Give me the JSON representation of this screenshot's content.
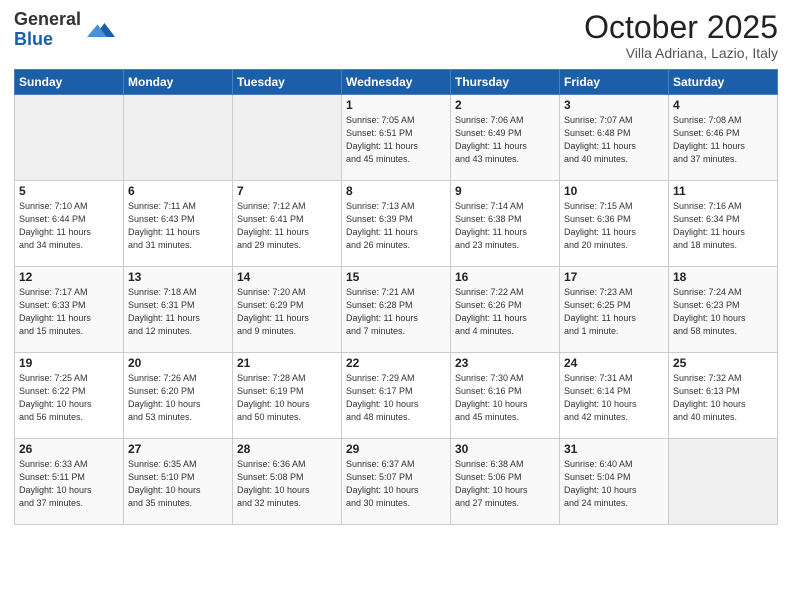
{
  "logo": {
    "general": "General",
    "blue": "Blue"
  },
  "header": {
    "month": "October 2025",
    "location": "Villa Adriana, Lazio, Italy"
  },
  "weekdays": [
    "Sunday",
    "Monday",
    "Tuesday",
    "Wednesday",
    "Thursday",
    "Friday",
    "Saturday"
  ],
  "weeks": [
    [
      {
        "day": "",
        "info": ""
      },
      {
        "day": "",
        "info": ""
      },
      {
        "day": "",
        "info": ""
      },
      {
        "day": "1",
        "info": "Sunrise: 7:05 AM\nSunset: 6:51 PM\nDaylight: 11 hours\nand 45 minutes."
      },
      {
        "day": "2",
        "info": "Sunrise: 7:06 AM\nSunset: 6:49 PM\nDaylight: 11 hours\nand 43 minutes."
      },
      {
        "day": "3",
        "info": "Sunrise: 7:07 AM\nSunset: 6:48 PM\nDaylight: 11 hours\nand 40 minutes."
      },
      {
        "day": "4",
        "info": "Sunrise: 7:08 AM\nSunset: 6:46 PM\nDaylight: 11 hours\nand 37 minutes."
      }
    ],
    [
      {
        "day": "5",
        "info": "Sunrise: 7:10 AM\nSunset: 6:44 PM\nDaylight: 11 hours\nand 34 minutes."
      },
      {
        "day": "6",
        "info": "Sunrise: 7:11 AM\nSunset: 6:43 PM\nDaylight: 11 hours\nand 31 minutes."
      },
      {
        "day": "7",
        "info": "Sunrise: 7:12 AM\nSunset: 6:41 PM\nDaylight: 11 hours\nand 29 minutes."
      },
      {
        "day": "8",
        "info": "Sunrise: 7:13 AM\nSunset: 6:39 PM\nDaylight: 11 hours\nand 26 minutes."
      },
      {
        "day": "9",
        "info": "Sunrise: 7:14 AM\nSunset: 6:38 PM\nDaylight: 11 hours\nand 23 minutes."
      },
      {
        "day": "10",
        "info": "Sunrise: 7:15 AM\nSunset: 6:36 PM\nDaylight: 11 hours\nand 20 minutes."
      },
      {
        "day": "11",
        "info": "Sunrise: 7:16 AM\nSunset: 6:34 PM\nDaylight: 11 hours\nand 18 minutes."
      }
    ],
    [
      {
        "day": "12",
        "info": "Sunrise: 7:17 AM\nSunset: 6:33 PM\nDaylight: 11 hours\nand 15 minutes."
      },
      {
        "day": "13",
        "info": "Sunrise: 7:18 AM\nSunset: 6:31 PM\nDaylight: 11 hours\nand 12 minutes."
      },
      {
        "day": "14",
        "info": "Sunrise: 7:20 AM\nSunset: 6:29 PM\nDaylight: 11 hours\nand 9 minutes."
      },
      {
        "day": "15",
        "info": "Sunrise: 7:21 AM\nSunset: 6:28 PM\nDaylight: 11 hours\nand 7 minutes."
      },
      {
        "day": "16",
        "info": "Sunrise: 7:22 AM\nSunset: 6:26 PM\nDaylight: 11 hours\nand 4 minutes."
      },
      {
        "day": "17",
        "info": "Sunrise: 7:23 AM\nSunset: 6:25 PM\nDaylight: 11 hours\nand 1 minute."
      },
      {
        "day": "18",
        "info": "Sunrise: 7:24 AM\nSunset: 6:23 PM\nDaylight: 10 hours\nand 58 minutes."
      }
    ],
    [
      {
        "day": "19",
        "info": "Sunrise: 7:25 AM\nSunset: 6:22 PM\nDaylight: 10 hours\nand 56 minutes."
      },
      {
        "day": "20",
        "info": "Sunrise: 7:26 AM\nSunset: 6:20 PM\nDaylight: 10 hours\nand 53 minutes."
      },
      {
        "day": "21",
        "info": "Sunrise: 7:28 AM\nSunset: 6:19 PM\nDaylight: 10 hours\nand 50 minutes."
      },
      {
        "day": "22",
        "info": "Sunrise: 7:29 AM\nSunset: 6:17 PM\nDaylight: 10 hours\nand 48 minutes."
      },
      {
        "day": "23",
        "info": "Sunrise: 7:30 AM\nSunset: 6:16 PM\nDaylight: 10 hours\nand 45 minutes."
      },
      {
        "day": "24",
        "info": "Sunrise: 7:31 AM\nSunset: 6:14 PM\nDaylight: 10 hours\nand 42 minutes."
      },
      {
        "day": "25",
        "info": "Sunrise: 7:32 AM\nSunset: 6:13 PM\nDaylight: 10 hours\nand 40 minutes."
      }
    ],
    [
      {
        "day": "26",
        "info": "Sunrise: 6:33 AM\nSunset: 5:11 PM\nDaylight: 10 hours\nand 37 minutes."
      },
      {
        "day": "27",
        "info": "Sunrise: 6:35 AM\nSunset: 5:10 PM\nDaylight: 10 hours\nand 35 minutes."
      },
      {
        "day": "28",
        "info": "Sunrise: 6:36 AM\nSunset: 5:08 PM\nDaylight: 10 hours\nand 32 minutes."
      },
      {
        "day": "29",
        "info": "Sunrise: 6:37 AM\nSunset: 5:07 PM\nDaylight: 10 hours\nand 30 minutes."
      },
      {
        "day": "30",
        "info": "Sunrise: 6:38 AM\nSunset: 5:06 PM\nDaylight: 10 hours\nand 27 minutes."
      },
      {
        "day": "31",
        "info": "Sunrise: 6:40 AM\nSunset: 5:04 PM\nDaylight: 10 hours\nand 24 minutes."
      },
      {
        "day": "",
        "info": ""
      }
    ]
  ]
}
